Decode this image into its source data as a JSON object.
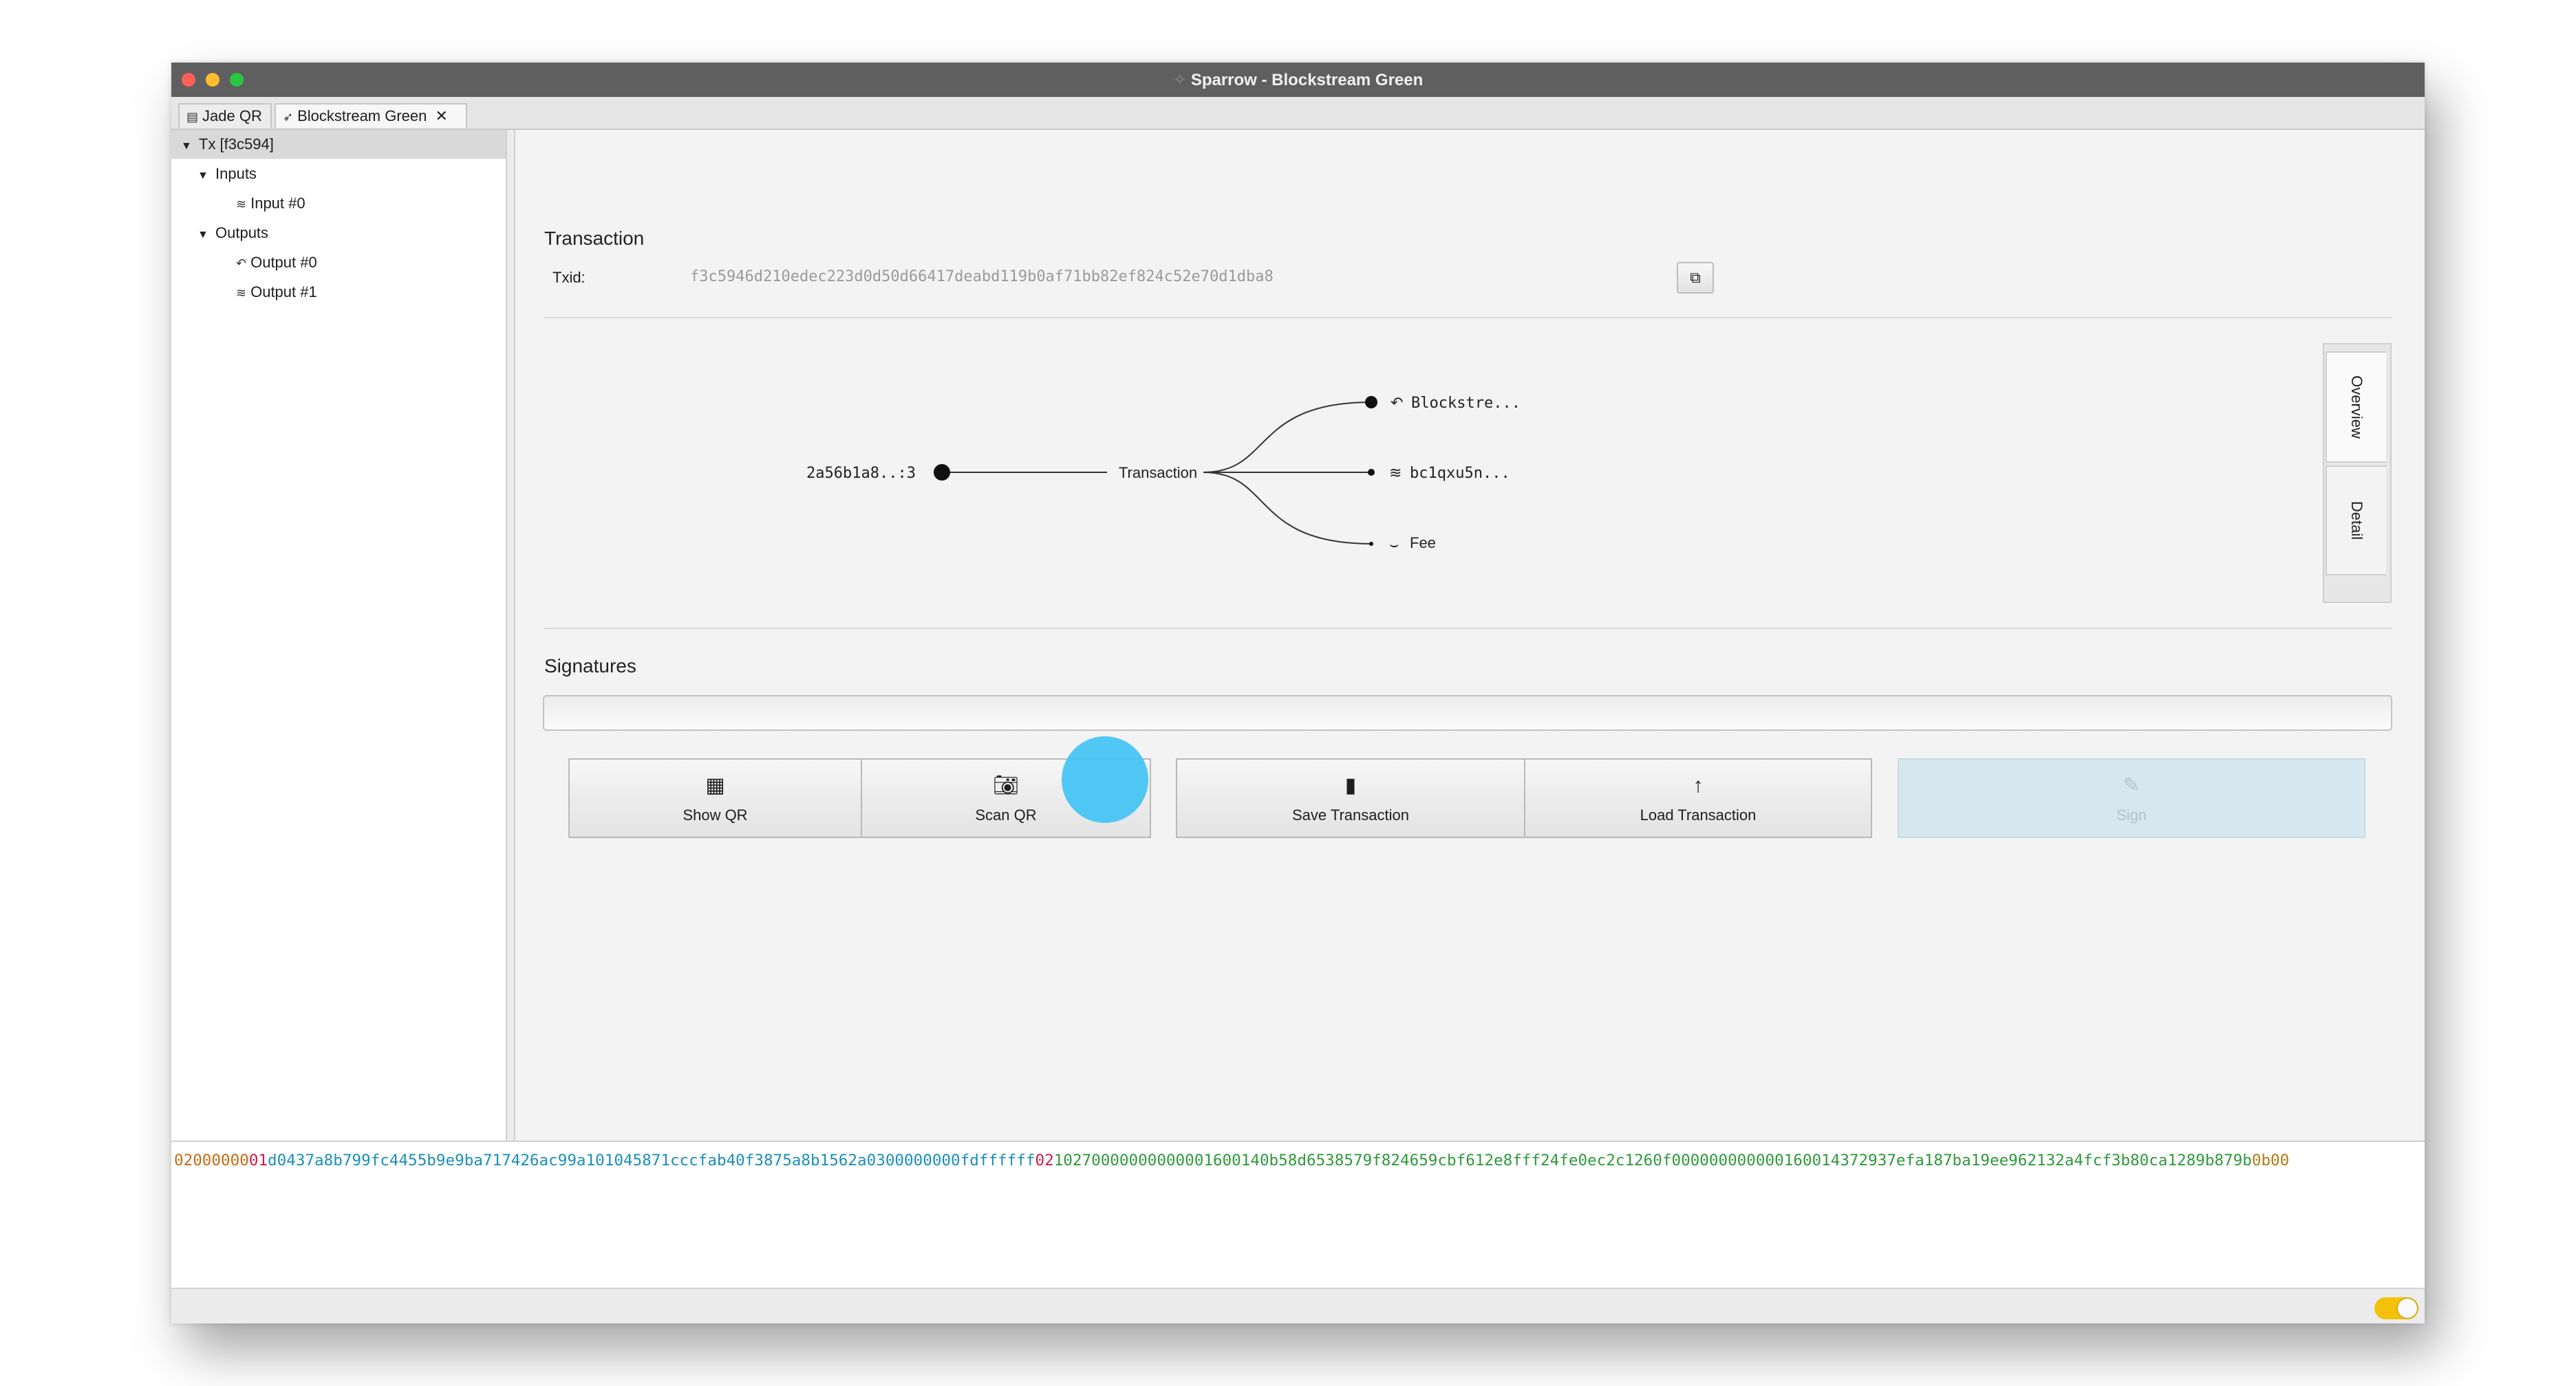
{
  "window": {
    "title": "Sparrow - Blockstream Green",
    "traffic_lights": [
      "#fe5f57",
      "#febc2e",
      "#28c840"
    ]
  },
  "tabs": [
    {
      "label": "Jade QR",
      "icon": "wallet-icon"
    },
    {
      "label": "Blockstream Green",
      "icon": "send-icon",
      "close": "✕"
    }
  ],
  "tree": {
    "root": "Tx [f3c594]",
    "inputs": "Inputs",
    "input0": "Input #0",
    "outputs": "Outputs",
    "output0": "Output #0",
    "output1": "Output #1"
  },
  "transaction": {
    "title": "Transaction",
    "txid_label": "Txid:",
    "txid": "f3c5946d210edec223d0d50d66417deabd119b0af71bb82ef824c52e70d1dba8"
  },
  "diagram": {
    "input": "2a56b1a8..:3",
    "center": "Transaction",
    "outputs": [
      "Blockstre...",
      "bc1qxu5n...",
      "Fee"
    ]
  },
  "side_tabs": {
    "overview": "Overview",
    "detail": "Detail"
  },
  "signatures": {
    "title": "Signatures"
  },
  "buttons": {
    "show_qr": "Show QR",
    "scan_qr": "Scan QR",
    "save_tx": "Save Transaction",
    "load_tx": "Load Transaction",
    "sign": "Sign"
  },
  "hex": {
    "version": "02000000",
    "input_count": "01",
    "inputs": "d0437a8b799fc4455b9e9ba717426ac99a101045871cccfab40f3875a8b1562a0300000000fdffffff",
    "output_count": "02",
    "outputs": "1027000000000000160014",
    "outputs2": "0b58d6538579f824659cbf612e8fff24fe0ec2c1260f00000000000016001",
    "outputs3": "4372937efa187ba19ee962132a4fcf3b80ca1289b879b",
    "locktime": "0b00"
  },
  "colors": {
    "version": "#c56b10",
    "input_count": "#d01a4a",
    "inputs": "#1a8fb8",
    "output_count": "#d01a4a",
    "outputs": "#2e9a3a",
    "locktime": "#b07a10",
    "accent": "#3ec2f5",
    "toggle": "#f4c20d"
  }
}
